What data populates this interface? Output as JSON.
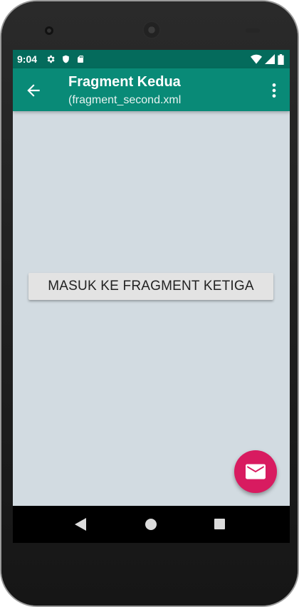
{
  "status_bar": {
    "time": "9:04",
    "left_icons": [
      "gear-icon",
      "shield-icon",
      "sd-card-icon"
    ],
    "right_icons": [
      "wifi-icon",
      "signal-icon",
      "battery-icon"
    ]
  },
  "app_bar": {
    "title": "Fragment Kedua",
    "subtitle": "(fragment_second.xml",
    "nav_icon": "back-arrow-icon",
    "menu_icon": "more-vert-icon"
  },
  "content": {
    "button_label": "MASUK KE FRAGMENT KETIGA"
  },
  "fab": {
    "icon": "email-icon"
  },
  "nav_bar": {
    "buttons": [
      "back-icon",
      "home-icon",
      "recents-icon"
    ]
  },
  "colors": {
    "status_bar": "#046b5c",
    "app_bar": "#098a77",
    "background": "#d2dbe1",
    "fab": "#d81b60"
  }
}
